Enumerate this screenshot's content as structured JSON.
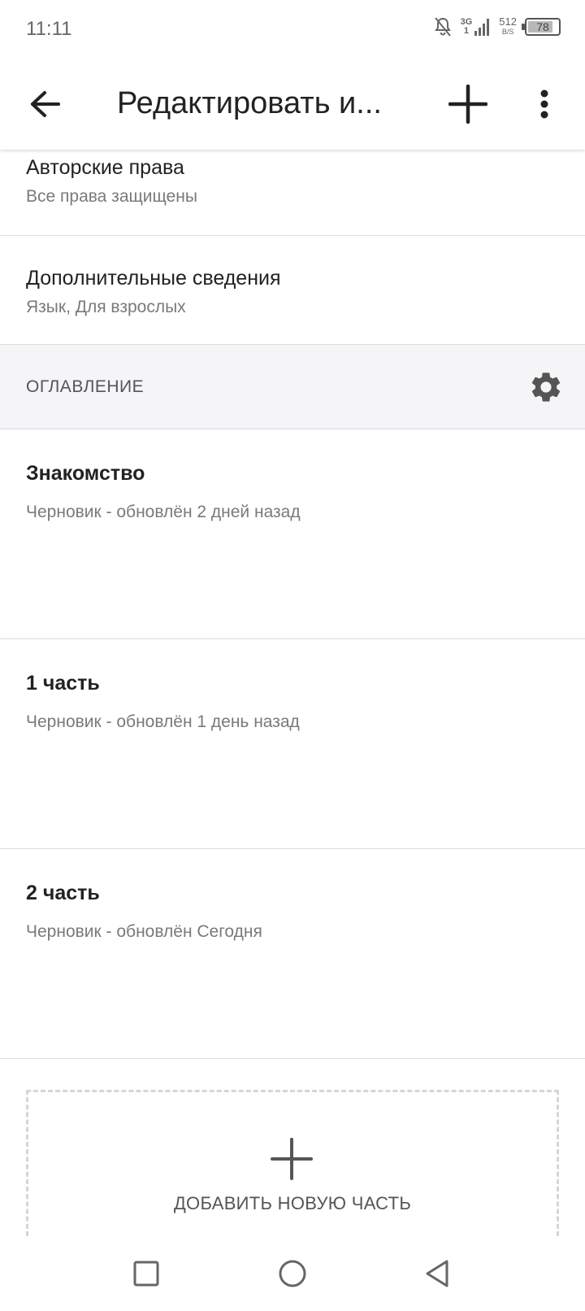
{
  "status_bar": {
    "time": "11:11",
    "network_top": "3G",
    "network_bottom": "1",
    "speed_value": "512",
    "speed_unit": "B/S",
    "battery_level": "78"
  },
  "app_bar": {
    "title": "Редактировать и..."
  },
  "details": {
    "copyright_title": "Авторские права",
    "copyright_value": "Все права защищены",
    "extra_title": "Дополнительные сведения",
    "extra_value": "Язык, Для взрослых"
  },
  "toc": {
    "header": "ОГЛАВЛЕНИЕ",
    "parts": [
      {
        "title": "Знакомство",
        "status": "Черновик - обновлён 2 дней назад"
      },
      {
        "title": "1 часть",
        "status": "Черновик - обновлён 1 день назад"
      },
      {
        "title": "2 часть",
        "status": "Черновик - обновлён Сегодня"
      }
    ],
    "add_part_label": "ДОБАВИТЬ НОВУЮ ЧАСТЬ"
  },
  "colors": {
    "text_primary": "#222222",
    "text_secondary": "#7a7a7a",
    "section_background": "#f5f4f7",
    "divider": "#dcdcdc",
    "icon": "#555555"
  },
  "icons": {
    "back": "arrow-left-icon",
    "add": "plus-icon",
    "more": "more-vertical-icon",
    "toc_settings": "gear-icon",
    "add_part": "plus-icon",
    "nav_recents": "square-icon",
    "nav_home": "circle-icon",
    "nav_back": "triangle-back-icon"
  }
}
